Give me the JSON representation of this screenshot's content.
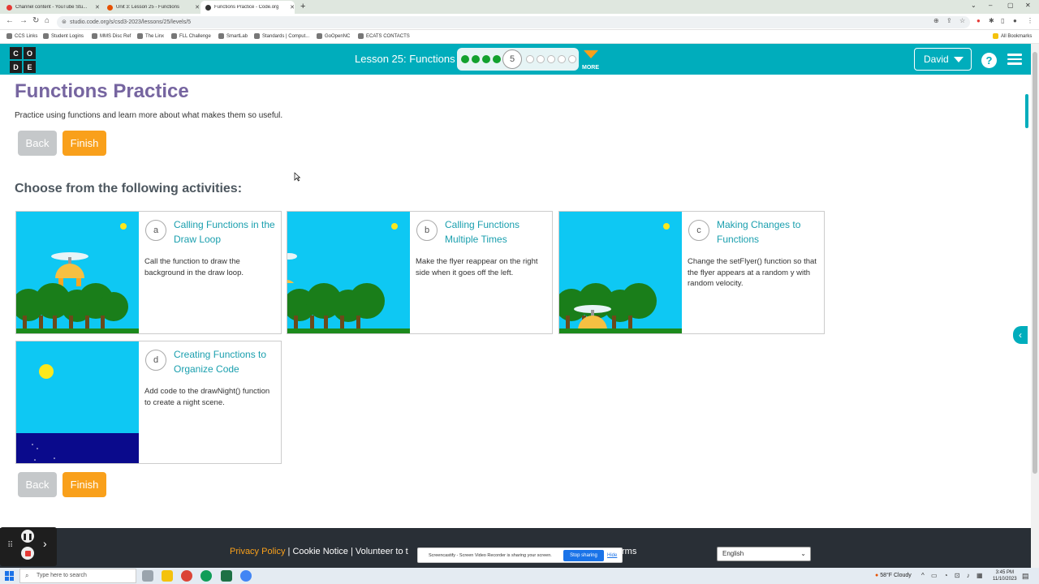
{
  "browser": {
    "tabs": [
      {
        "label": "Channel content - YouTube Stu...",
        "active": false,
        "icon_color": "#e53935"
      },
      {
        "label": "Unit 3: Lesson 25 - Functions",
        "active": false,
        "icon_color": "#e65100"
      },
      {
        "label": "Functions Practice - Code.org",
        "active": true,
        "icon_color": "#333333"
      }
    ],
    "url": "studio.code.org/s/csd3-2023/lessons/25/levels/5",
    "bookmarks": [
      "CCS Links",
      "Student Logins",
      "MMS Disc Ref",
      "The Linx",
      "FLL Challenge",
      "SmartLab",
      "Standards | Comput...",
      "GoOpenNC",
      "ECATS CONTACTS"
    ],
    "all_bookmarks": "All Bookmarks"
  },
  "header": {
    "logo_letters": [
      "C",
      "O",
      "D",
      "E"
    ],
    "lesson_title": "Lesson 25: Functions",
    "progress": {
      "completed": 4,
      "current": "5",
      "remaining": 5
    },
    "more_label": "MORE",
    "user_name": "David",
    "help_label": "?"
  },
  "main": {
    "title": "Functions Practice",
    "description": "Practice using functions and learn more about what makes them so useful.",
    "back_label": "Back",
    "finish_label": "Finish",
    "choose_heading": "Choose from the following activities:",
    "activities": [
      {
        "letter": "a",
        "title": "Calling Functions in the Draw Loop",
        "description": "Call the function to draw the background in the draw loop."
      },
      {
        "letter": "b",
        "title": "Calling Functions Multiple Times",
        "description": "Make the flyer reappear on the right side when it goes off the left."
      },
      {
        "letter": "c",
        "title": "Making Changes to Functions",
        "description": "Change the setFlyer() function so that the flyer appears at a random y with random velocity."
      },
      {
        "letter": "d",
        "title": "Creating Functions to Organize Code",
        "description": "Add code to the drawNight() function to create a night scene."
      }
    ]
  },
  "footer": {
    "privacy_policy": "Privacy Policy",
    "links_text": " | Cookie Notice | Volunteer to t",
    "terms_fragment": "rms",
    "language": "English"
  },
  "screencastify": {
    "message": "Screencastify - Screen Video Recorder is sharing your screen.",
    "stop_label": "Stop sharing",
    "hide_label": "Hide"
  },
  "taskbar": {
    "search_placeholder": "Type here to search",
    "weather": "58°F  Cloudy",
    "time": "3:45 PM",
    "date": "11/10/2023"
  },
  "colors": {
    "accent_teal": "#00adbc",
    "title_purple": "#7665a0",
    "finish_orange": "#f9a01b",
    "progress_green": "#12a12e"
  }
}
